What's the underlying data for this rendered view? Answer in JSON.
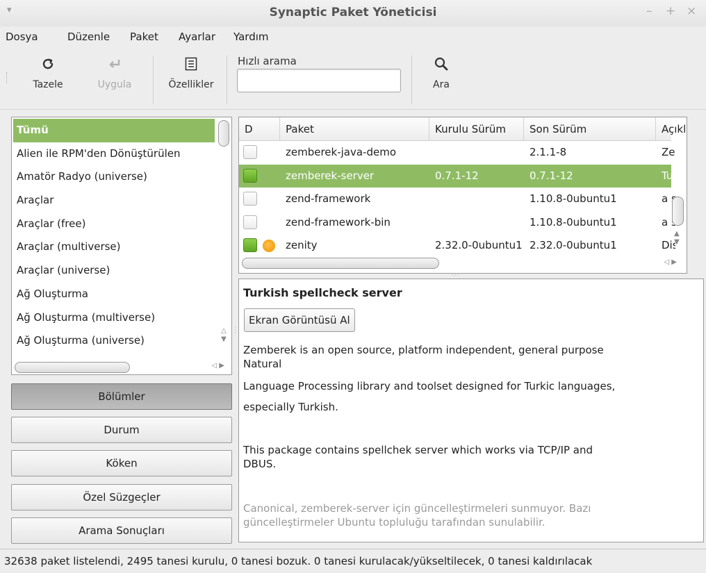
{
  "window": {
    "title": "Synaptic Paket Yöneticisi",
    "menu_glyph": "▾",
    "minimize": "–",
    "maximize": "+",
    "close": "×"
  },
  "menubar": {
    "items": [
      "Dosya",
      "Düzenle",
      "Paket",
      "Ayarlar",
      "Yardım"
    ]
  },
  "toolbar": {
    "reload_label": "Tazele",
    "reload_icon": "refresh-icon",
    "apply_label": "Uygula",
    "apply_icon": "apply-arrow-icon",
    "apply_enabled": false,
    "properties_label": "Özellikler",
    "properties_icon": "properties-icon",
    "quick_search_label": "Hızlı arama",
    "quick_search_value": "",
    "search_label": "Ara",
    "search_icon": "search-icon"
  },
  "categories": {
    "items": [
      "Tümü",
      "Alien ile RPM'den Dönüştürülen",
      "Amatör Radyo (universe)",
      "Araçlar",
      "Araçlar (free)",
      "Araçlar (multiverse)",
      "Araçlar (universe)",
      "Ağ Oluşturma",
      "Ağ Oluşturma (multiverse)",
      "Ağ Oluşturma (universe)"
    ],
    "selected": "Tümü"
  },
  "filters": {
    "sections": "Bölümler",
    "status": "Durum",
    "origin": "Köken",
    "custom": "Özel Süzgeçler",
    "search_results": "Arama Sonuçları",
    "active": "Bölümler"
  },
  "packages": {
    "columns": [
      "D",
      "Paket",
      "Kurulu Sürüm",
      "Son Sürüm",
      "Açıklama"
    ],
    "rows": [
      {
        "name": "zemberek-java-demo",
        "installed": "",
        "latest": "2.1.1-8",
        "desc": "Zemberek",
        "checked": false,
        "supported": false
      },
      {
        "name": "zemberek-server",
        "installed": "0.7.1-12",
        "latest": "0.7.1-12",
        "desc": "Turkish",
        "checked": true,
        "supported": false
      },
      {
        "name": "zend-framework",
        "installed": "",
        "latest": "1.10.8-0ubuntu1",
        "desc": "a simple",
        "checked": false,
        "supported": false
      },
      {
        "name": "zend-framework-bin",
        "installed": "",
        "latest": "1.10.8-0ubuntu1",
        "desc": "a simple",
        "checked": false,
        "supported": false
      },
      {
        "name": "zenity",
        "installed": "2.32.0-0ubuntu1",
        "latest": "2.32.0-0ubuntu1",
        "desc": "Display",
        "checked": true,
        "supported": true
      }
    ],
    "selected": "zemberek-server"
  },
  "description": {
    "title": "Turkish spellcheck server",
    "screenshot_button": "Ekran Görüntüsü Al",
    "para1_line1": "Zemberek is an open source, platform independent, general purpose",
    "para1_line2": "Natural",
    "para2_line1": "Language Processing library and toolset designed for Turkic languages,",
    "para2_line2": "especially Turkish.",
    "para3_line1": "This package contains spellchek server which works via TCP/IP and",
    "para3_line2": "DBUS.",
    "notice_line1": "Canonical, zemberek-server için güncelleştirmeleri sunmuyor. Bazı",
    "notice_line2": "güncelleştirmeler Ubuntu topluluğu tarafından sunulabilir."
  },
  "status": {
    "text": "32638 paket listelendi, 2495 tanesi kurulu, 0 tanesi bozuk. 0 tanesi kurulacak/yükseltilecek, 0 tanesi kaldırılacak"
  },
  "colors": {
    "selection": "#8fbc63",
    "checkbox_on": "#5fa625",
    "supported_badge": "#f08c00"
  }
}
